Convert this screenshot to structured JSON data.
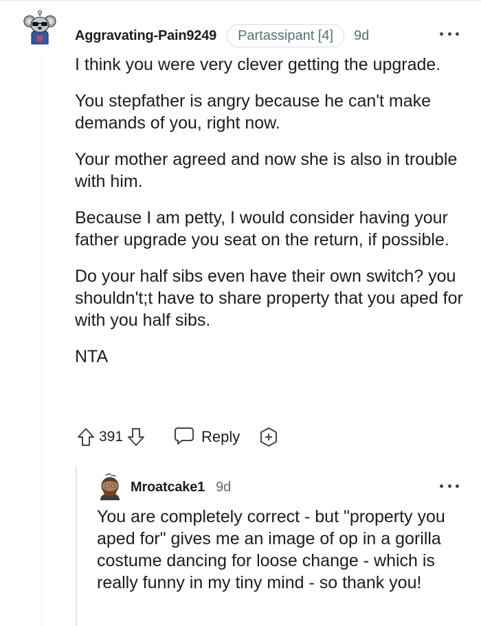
{
  "comment": {
    "author": "Aggravating-Pain9249",
    "flair": "Partassipant [4]",
    "time": "9d",
    "paragraphs": [
      "I think you were very clever getting the upgrade.",
      "You stepfather is angry because he can't make demands of you, right now.",
      "Your mother agreed and now she is also in trouble with him.",
      "Because I am petty, I would consider having your father upgrade you seat on the return, if possible.",
      "Do your half sibs even have their own switch? you shouldn't;t have to share property that you aped for with you half sibs.",
      "NTA"
    ],
    "votes": "391",
    "reply_label": "Reply",
    "icons": {
      "avatar": "koala-avatar-icon",
      "more": "more-options-icon",
      "upvote": "upvote-arrow-icon",
      "downvote": "downvote-arrow-icon",
      "reply": "speech-bubble-icon",
      "award": "award-plus-icon"
    }
  },
  "reply": {
    "author": "Mroatcake1",
    "time": "9d",
    "body": "You are completely correct - but \"property you aped for\" gives me an image of op in a gorilla costume dancing for loose change - which is really funny in my tiny mind - so thank you!",
    "icons": {
      "avatar": "bearded-avatar-icon",
      "more": "more-options-icon"
    }
  },
  "colors": {
    "text": "#1c1c1c",
    "meta": "#576f76",
    "border": "#d9dbdd",
    "icon": "#3f4449"
  }
}
